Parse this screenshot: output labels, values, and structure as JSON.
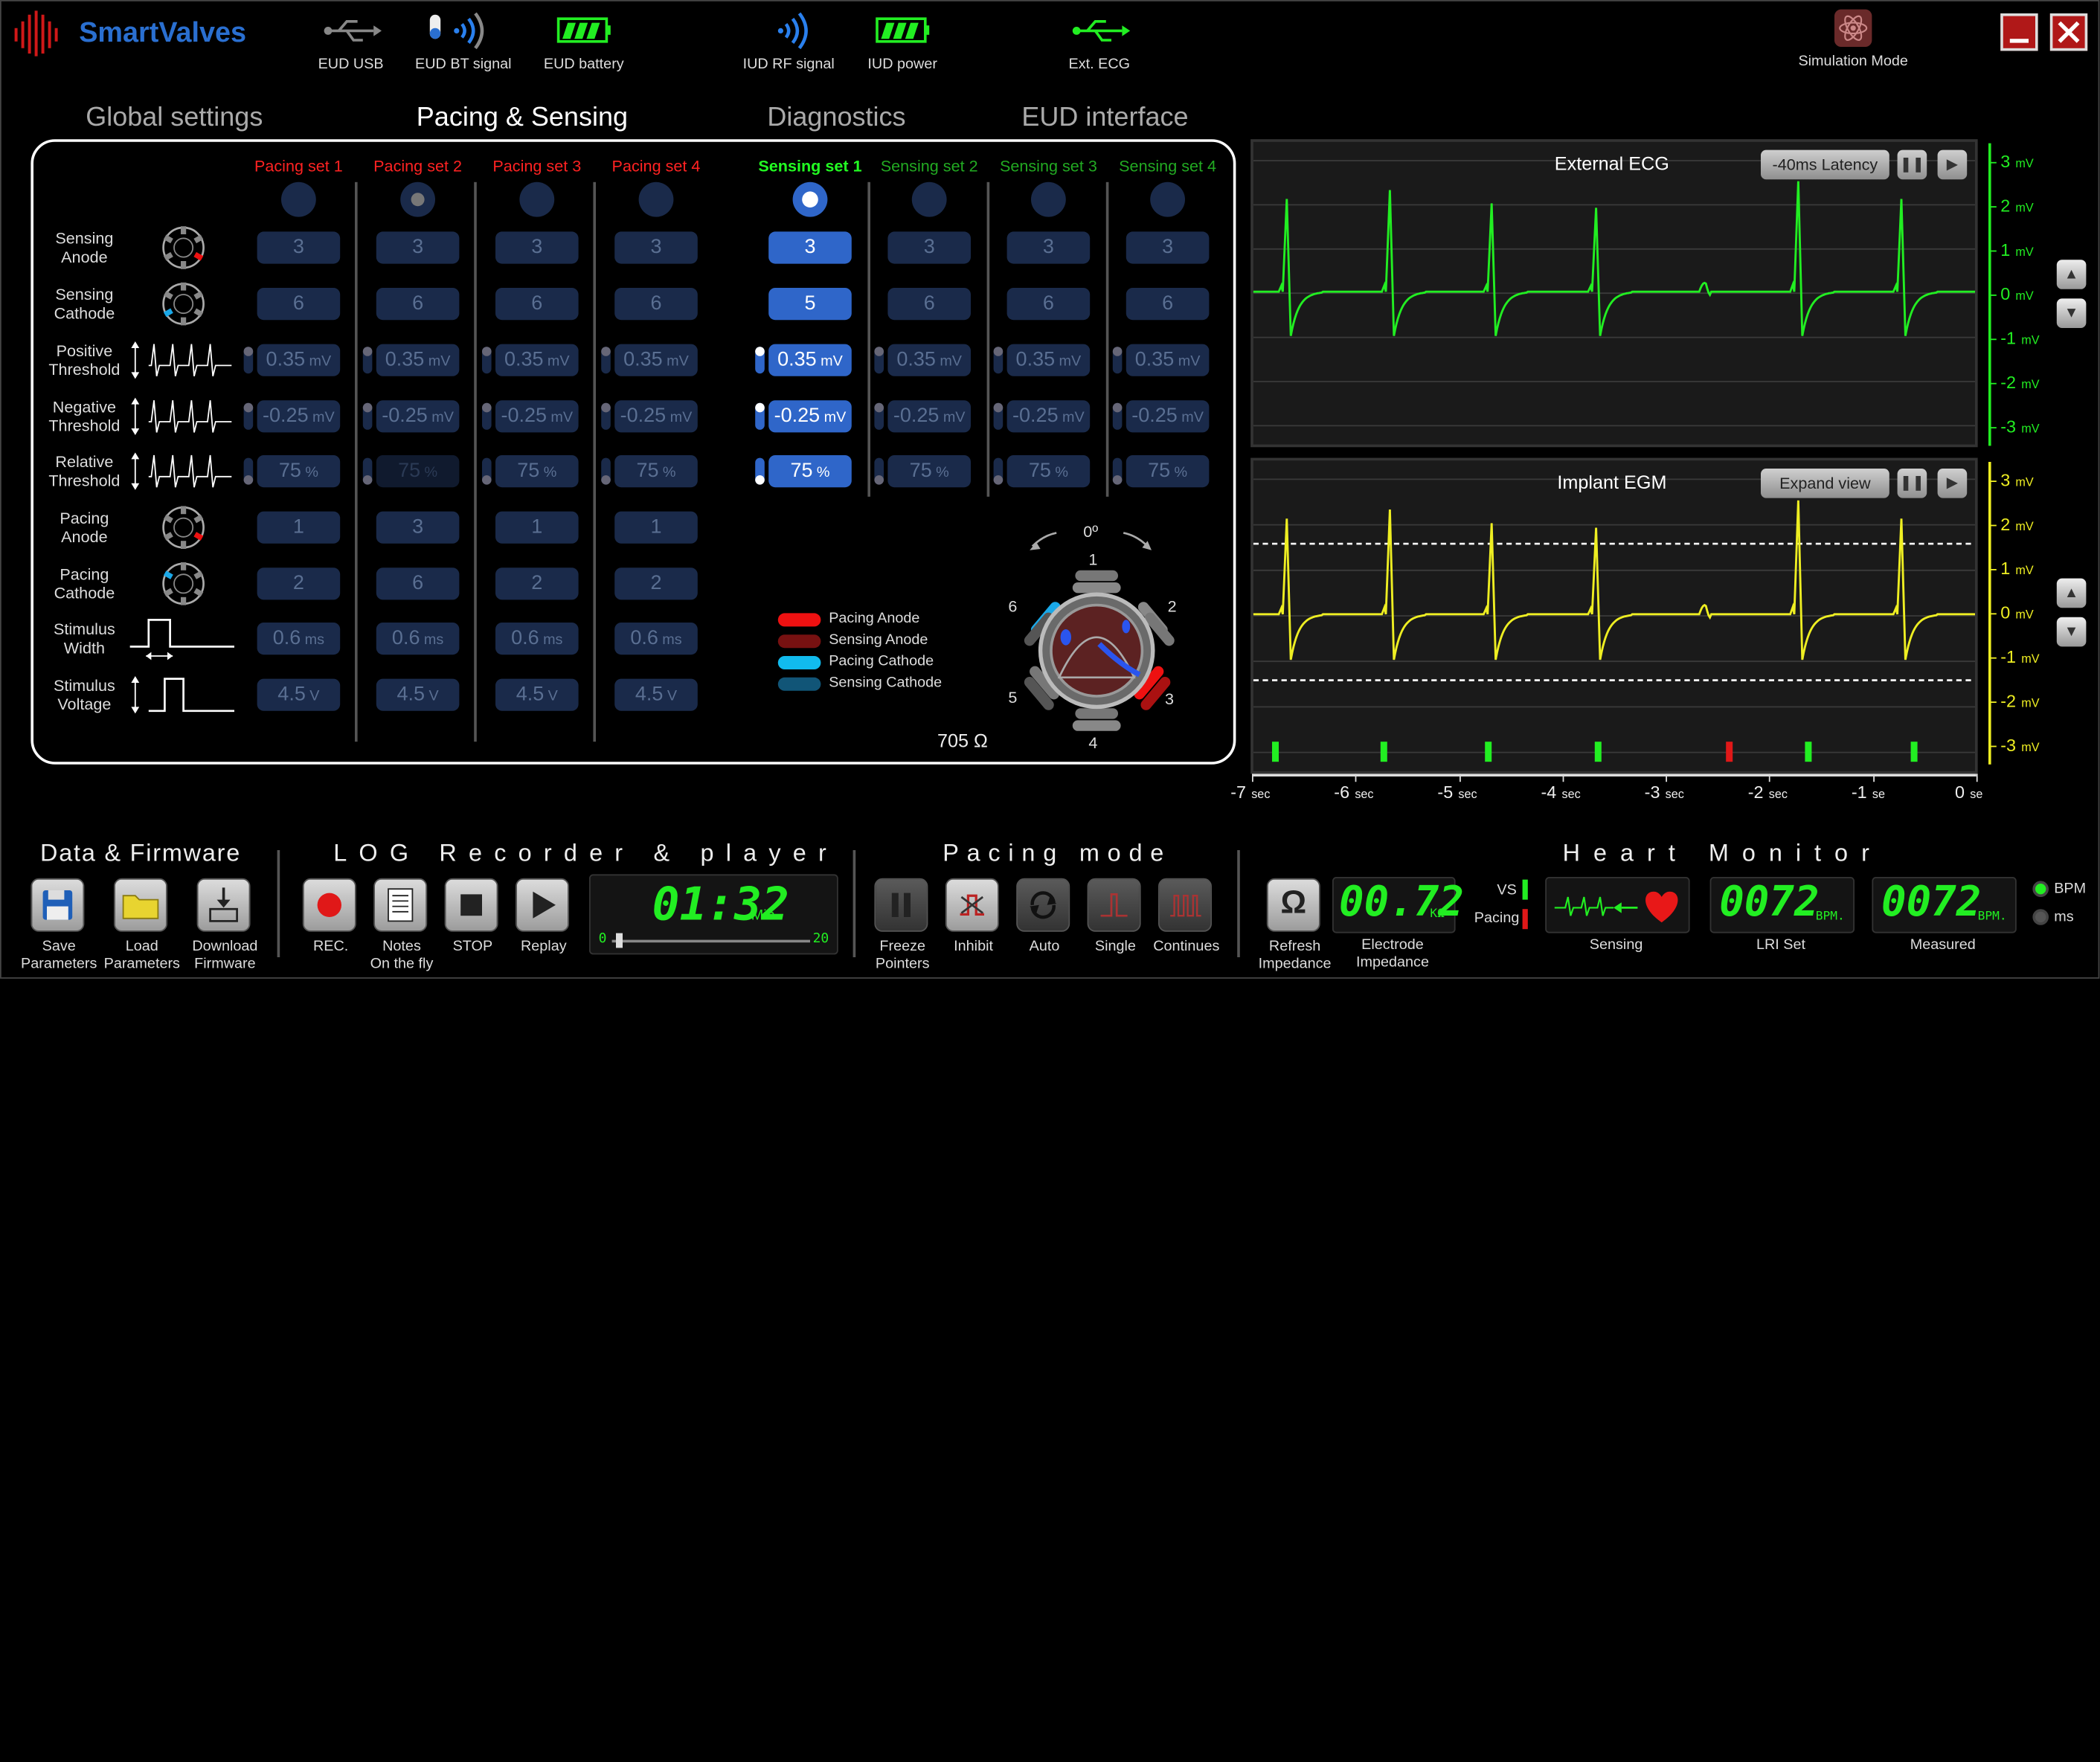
{
  "app": {
    "name": "SmartValves"
  },
  "status": [
    {
      "label": "EUD USB"
    },
    {
      "label": "EUD BT signal"
    },
    {
      "label": "EUD battery"
    },
    {
      "label": "IUD RF signal"
    },
    {
      "label": "IUD power"
    },
    {
      "label": "Ext. ECG"
    }
  ],
  "sim_mode": "Simulation Mode",
  "tabs": [
    "Global settings",
    "Pacing & Sensing",
    "Diagnostics",
    "EUD interface"
  ],
  "row_labels": [
    "Sensing\nAnode",
    "Sensing\nCathode",
    "Positive\nThreshold",
    "Negative\nThreshold",
    "Relative\nThreshold",
    "Pacing\nAnode",
    "Pacing\nCathode",
    "Stimulus\nWidth",
    "Stimulus\nVoltage"
  ],
  "sets": [
    {
      "title": "Pacing set 1",
      "color": "#ff2222",
      "selected": false,
      "values": [
        "3",
        "6",
        "0.35",
        "-0.25",
        "75",
        "1",
        "2",
        "0.6",
        "4.5"
      ]
    },
    {
      "title": "Pacing set 2",
      "color": "#ff2222",
      "selected": false,
      "values": [
        "3",
        "6",
        "0.35",
        "-0.25",
        "75",
        "3",
        "6",
        "0.6",
        "4.5"
      ]
    },
    {
      "title": "Pacing set 3",
      "color": "#ff2222",
      "selected": false,
      "values": [
        "3",
        "6",
        "0.35",
        "-0.25",
        "75",
        "1",
        "2",
        "0.6",
        "4.5"
      ]
    },
    {
      "title": "Pacing set 4",
      "color": "#ff2222",
      "selected": false,
      "values": [
        "3",
        "6",
        "0.35",
        "-0.25",
        "75",
        "1",
        "2",
        "0.6",
        "4.5"
      ]
    },
    {
      "title": "Sensing set 1",
      "color": "#22ff22",
      "selected": true,
      "values": [
        "3",
        "5",
        "0.35",
        "-0.25",
        "75"
      ]
    },
    {
      "title": "Sensing set 2",
      "color": "#22aa22",
      "selected": false,
      "values": [
        "3",
        "6",
        "0.35",
        "-0.25",
        "75"
      ]
    },
    {
      "title": "Sensing set 3",
      "color": "#22aa22",
      "selected": false,
      "values": [
        "3",
        "6",
        "0.35",
        "-0.25",
        "75"
      ]
    },
    {
      "title": "Sensing set 4",
      "color": "#22aa22",
      "selected": false,
      "values": [
        "3",
        "6",
        "0.35",
        "-0.25",
        "75"
      ]
    }
  ],
  "units": {
    "mv": "mV",
    "pct": "%",
    "ms": "ms",
    "v": "V"
  },
  "legend": [
    {
      "label": "Pacing Anode",
      "color": "#ee1111"
    },
    {
      "label": "Sensing Anode",
      "color": "#771111"
    },
    {
      "label": "Pacing Cathode",
      "color": "#11bbee"
    },
    {
      "label": "Sensing Cathode",
      "color": "#115577"
    }
  ],
  "electrode": {
    "angle": "0º",
    "labels": [
      "1",
      "2",
      "3",
      "4",
      "5",
      "6"
    ],
    "impedance": "705 Ω"
  },
  "ecg": {
    "title": "External ECG",
    "button": "-40ms Latency",
    "color": "#22ee22"
  },
  "egm": {
    "title": "Implant EGM",
    "button": "Expand view",
    "color": "#eeee22"
  },
  "yaxis": {
    "ticks": [
      "3",
      "2",
      "1",
      "0",
      "-1",
      "-2",
      "-3"
    ],
    "unit": "mV"
  },
  "xaxis": {
    "ticks": [
      "-7",
      "-6",
      "-5",
      "-4",
      "-3",
      "-2",
      "-1",
      "0"
    ],
    "units": [
      "sec",
      "sec",
      "sec",
      "sec",
      "sec",
      "sec",
      "se",
      "se"
    ]
  },
  "markers": [
    "green",
    "green",
    "green",
    "green",
    "red",
    "green",
    "green"
  ],
  "bottom": {
    "data_fw": {
      "title": "Data & Firmware",
      "buttons": [
        "Save\nParameters",
        "Load\nParameters",
        "Download\nFirmware"
      ]
    },
    "log": {
      "title": "LOG Recorder & player",
      "buttons": [
        "REC.",
        "Notes\nOn the fly",
        "STOP",
        "Replay"
      ],
      "time": "01:32",
      "time_unit": "Min.",
      "slider_min": "0",
      "slider_max": "20"
    },
    "pacing": {
      "title": "Pacing mode",
      "buttons": [
        "Freeze\nPointers",
        "Inhibit",
        "Auto",
        "Single",
        "Continues"
      ]
    },
    "heart": {
      "title": "Heart Monitor",
      "refresh": "Refresh\nImpedance",
      "electrode_imp": "00.72",
      "electrode_unit": "KΩ",
      "electrode_caption": "Electrode\nImpedance",
      "vs": "VS",
      "pacing": "Pacing",
      "sensing": "Sensing",
      "lri": "0072",
      "lri_unit": "BPM.",
      "lri_caption": "LRI Set",
      "measured": "0072",
      "measured_unit": "BPM.",
      "measured_caption": "Measured",
      "radio": [
        "BPM",
        "ms"
      ]
    }
  }
}
